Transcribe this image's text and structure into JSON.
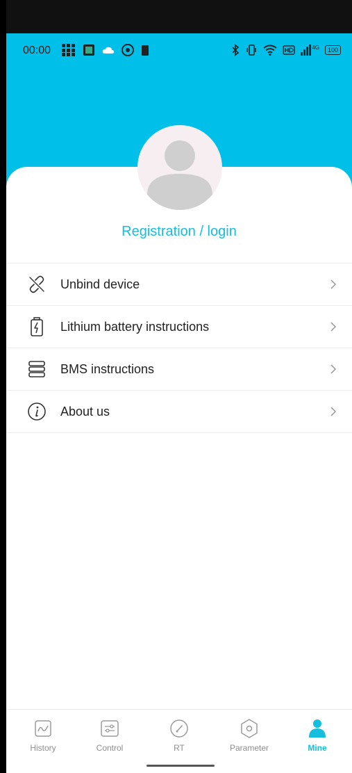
{
  "status_bar": {
    "time": "00:00",
    "network": "4G",
    "battery": "100"
  },
  "profile": {
    "login_label": "Registration / login"
  },
  "menu": {
    "items": [
      {
        "label": "Unbind device",
        "icon": "unlink-icon"
      },
      {
        "label": "Lithium battery instructions",
        "icon": "battery-icon"
      },
      {
        "label": "BMS instructions",
        "icon": "server-icon"
      },
      {
        "label": "About us",
        "icon": "info-icon"
      }
    ]
  },
  "tabbar": {
    "tabs": [
      {
        "label": "History",
        "icon": "chart-icon",
        "active": false
      },
      {
        "label": "Control",
        "icon": "sliders-icon",
        "active": false
      },
      {
        "label": "RT",
        "icon": "gauge-icon",
        "active": false
      },
      {
        "label": "Parameter",
        "icon": "hexagon-icon",
        "active": false
      },
      {
        "label": "Mine",
        "icon": "user-icon",
        "active": true
      }
    ]
  },
  "colors": {
    "accent": "#15BEDC",
    "header": "#00BFE8"
  }
}
